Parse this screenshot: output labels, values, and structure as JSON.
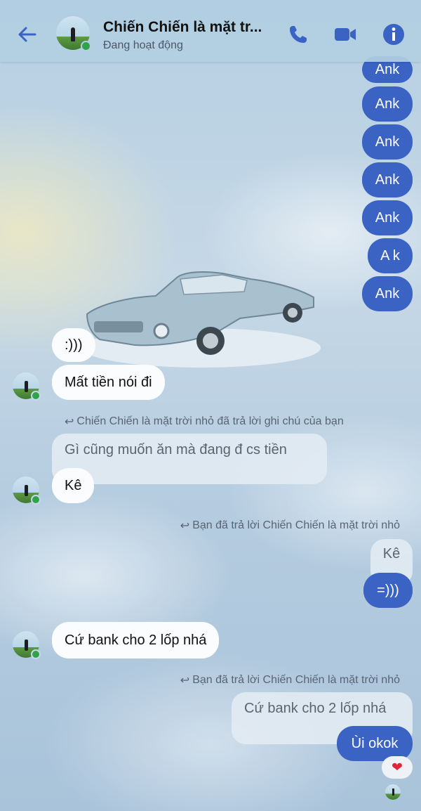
{
  "header": {
    "title": "Chiến Chiến là mặt tr...",
    "status": "Đang hoạt động",
    "icons": [
      "back-arrow-icon",
      "phone-icon",
      "video-camera-icon",
      "info-icon"
    ]
  },
  "outgoing_top": [
    "Ank",
    "Ank",
    "Ank",
    "Ank",
    "Ank",
    "A k",
    "Ank"
  ],
  "incoming1": [
    ":)))",
    "Mất tiền nói đi"
  ],
  "reply_note1": "Chiến Chiến là mặt trời nhỏ đã trả lời ghi chú của bạn",
  "quoted1": "Gì cũng muốn ăn mà đang đ cs tiền",
  "incoming2": "Kê",
  "reply_note2": "Bạn đã trả lời Chiến Chiến là mặt trời nhỏ",
  "quoted2": "Kê",
  "outgoing2": "=)))",
  "incoming3": "Cứ bank cho 2 lốp nhá",
  "reply_note3": "Bạn đã trả lời Chiến Chiến là mặt trời nhỏ",
  "quoted3": "Cứ bank cho 2 lốp nhá",
  "outgoing3": "Ùi okok",
  "reaction": "❤",
  "colors": {
    "accent": "#3b63c4",
    "online": "#31a24c"
  }
}
